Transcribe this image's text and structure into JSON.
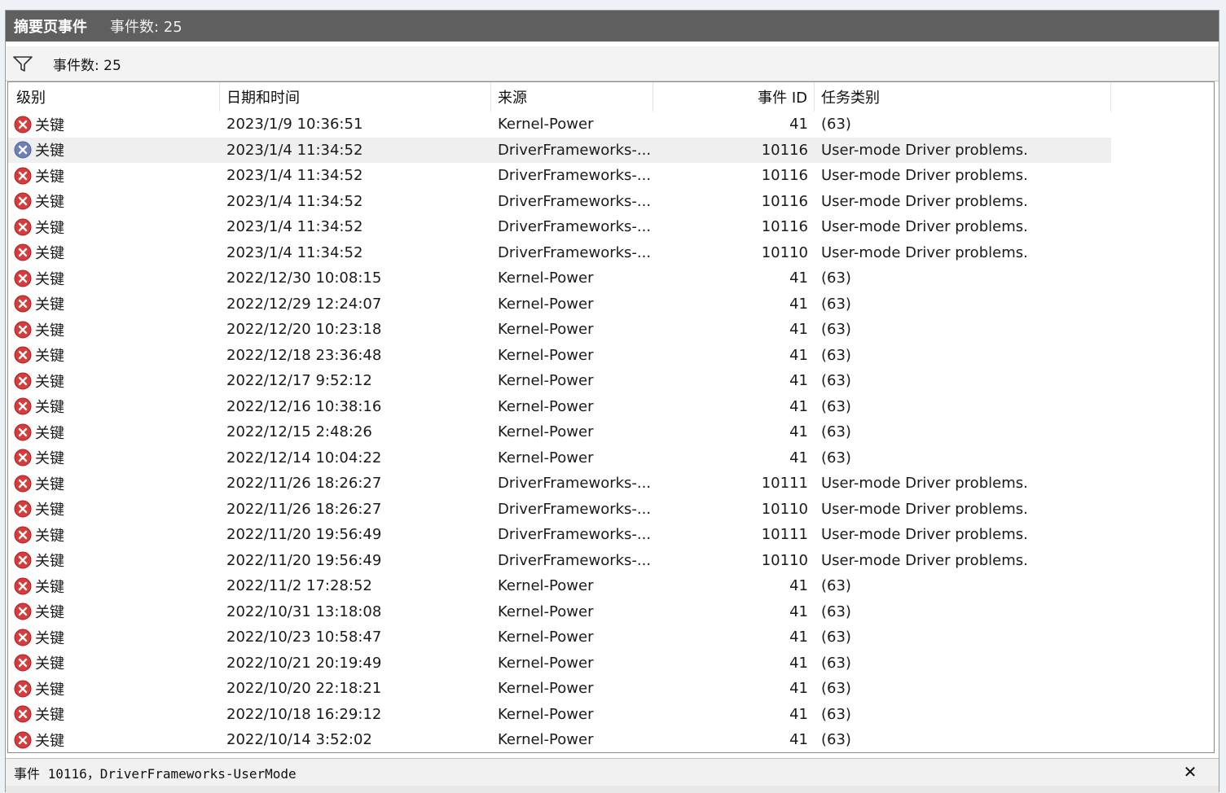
{
  "panel": {
    "title": "摘要页事件",
    "count_label": "事件数: 25"
  },
  "toolbar": {
    "count_text": "事件数: 25"
  },
  "table": {
    "columns": [
      "级别",
      "日期和时间",
      "来源",
      "事件 ID",
      "任务类别"
    ],
    "rows": [
      {
        "level": "关键",
        "date": "2023/1/9 10:36:51",
        "source": "Kernel-Power",
        "id": "41",
        "task": "(63)"
      },
      {
        "level": "关键",
        "date": "2023/1/4 11:34:52",
        "source": "DriverFrameworks-...",
        "id": "10116",
        "task": "User-mode Driver problems."
      },
      {
        "level": "关键",
        "date": "2023/1/4 11:34:52",
        "source": "DriverFrameworks-...",
        "id": "10116",
        "task": "User-mode Driver problems."
      },
      {
        "level": "关键",
        "date": "2023/1/4 11:34:52",
        "source": "DriverFrameworks-...",
        "id": "10116",
        "task": "User-mode Driver problems."
      },
      {
        "level": "关键",
        "date": "2023/1/4 11:34:52",
        "source": "DriverFrameworks-...",
        "id": "10116",
        "task": "User-mode Driver problems."
      },
      {
        "level": "关键",
        "date": "2023/1/4 11:34:52",
        "source": "DriverFrameworks-...",
        "id": "10110",
        "task": "User-mode Driver problems."
      },
      {
        "level": "关键",
        "date": "2022/12/30 10:08:15",
        "source": "Kernel-Power",
        "id": "41",
        "task": "(63)"
      },
      {
        "level": "关键",
        "date": "2022/12/29 12:24:07",
        "source": "Kernel-Power",
        "id": "41",
        "task": "(63)"
      },
      {
        "level": "关键",
        "date": "2022/12/20 10:23:18",
        "source": "Kernel-Power",
        "id": "41",
        "task": "(63)"
      },
      {
        "level": "关键",
        "date": "2022/12/18 23:36:48",
        "source": "Kernel-Power",
        "id": "41",
        "task": "(63)"
      },
      {
        "level": "关键",
        "date": "2022/12/17 9:52:12",
        "source": "Kernel-Power",
        "id": "41",
        "task": "(63)"
      },
      {
        "level": "关键",
        "date": "2022/12/16 10:38:16",
        "source": "Kernel-Power",
        "id": "41",
        "task": "(63)"
      },
      {
        "level": "关键",
        "date": "2022/12/15 2:48:26",
        "source": "Kernel-Power",
        "id": "41",
        "task": "(63)"
      },
      {
        "level": "关键",
        "date": "2022/12/14 10:04:22",
        "source": "Kernel-Power",
        "id": "41",
        "task": "(63)"
      },
      {
        "level": "关键",
        "date": "2022/11/26 18:26:27",
        "source": "DriverFrameworks-...",
        "id": "10111",
        "task": "User-mode Driver problems."
      },
      {
        "level": "关键",
        "date": "2022/11/26 18:26:27",
        "source": "DriverFrameworks-...",
        "id": "10110",
        "task": "User-mode Driver problems."
      },
      {
        "level": "关键",
        "date": "2022/11/20 19:56:49",
        "source": "DriverFrameworks-...",
        "id": "10111",
        "task": "User-mode Driver problems."
      },
      {
        "level": "关键",
        "date": "2022/11/20 19:56:49",
        "source": "DriverFrameworks-...",
        "id": "10110",
        "task": "User-mode Driver problems."
      },
      {
        "level": "关键",
        "date": "2022/11/2 17:28:52",
        "source": "Kernel-Power",
        "id": "41",
        "task": "(63)"
      },
      {
        "level": "关键",
        "date": "2022/10/31 13:18:08",
        "source": "Kernel-Power",
        "id": "41",
        "task": "(63)"
      },
      {
        "level": "关键",
        "date": "2022/10/23 10:58:47",
        "source": "Kernel-Power",
        "id": "41",
        "task": "(63)"
      },
      {
        "level": "关键",
        "date": "2022/10/21 20:19:49",
        "source": "Kernel-Power",
        "id": "41",
        "task": "(63)"
      },
      {
        "level": "关键",
        "date": "2022/10/20 22:18:21",
        "source": "Kernel-Power",
        "id": "41",
        "task": "(63)"
      },
      {
        "level": "关键",
        "date": "2022/10/18 16:29:12",
        "source": "Kernel-Power",
        "id": "41",
        "task": "(63)"
      },
      {
        "level": "关键",
        "date": "2022/10/14 3:52:02",
        "source": "Kernel-Power",
        "id": "41",
        "task": "(63)"
      }
    ]
  },
  "status": {
    "text": "事件 10116，DriverFrameworks-UserMode",
    "close": "✕"
  },
  "colors": {
    "critical_red": "#d83b3b",
    "title_bg": "#5f5f5f"
  }
}
